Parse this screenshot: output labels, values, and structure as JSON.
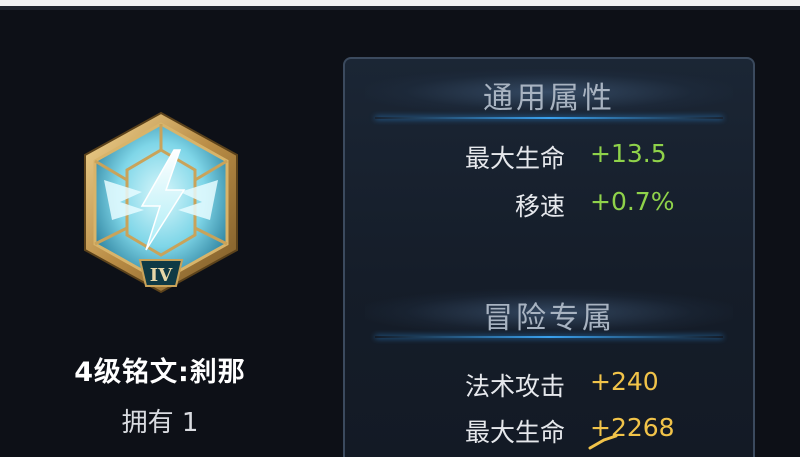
{
  "rune": {
    "icon": "lightning-rune-hexagon-icon",
    "level_numeral": "IV",
    "name": "4级铭文:刹那",
    "owned": "拥有 1"
  },
  "panel": {
    "general": {
      "title": "通用属性",
      "stats": [
        {
          "label": "最大生命",
          "value": "+13.5"
        },
        {
          "label": "移速",
          "value": "+0.7%"
        }
      ]
    },
    "adventure": {
      "title": "冒险专属",
      "stats": [
        {
          "label": "法术攻击",
          "value": "+240"
        },
        {
          "label": "最大生命",
          "value": "+2268"
        }
      ]
    }
  },
  "colors": {
    "general_value": "#8fd24a",
    "adventure_value": "#f1c349",
    "frame_gold": "#c9a35a",
    "crystal_blue": "#7fd6e8"
  }
}
